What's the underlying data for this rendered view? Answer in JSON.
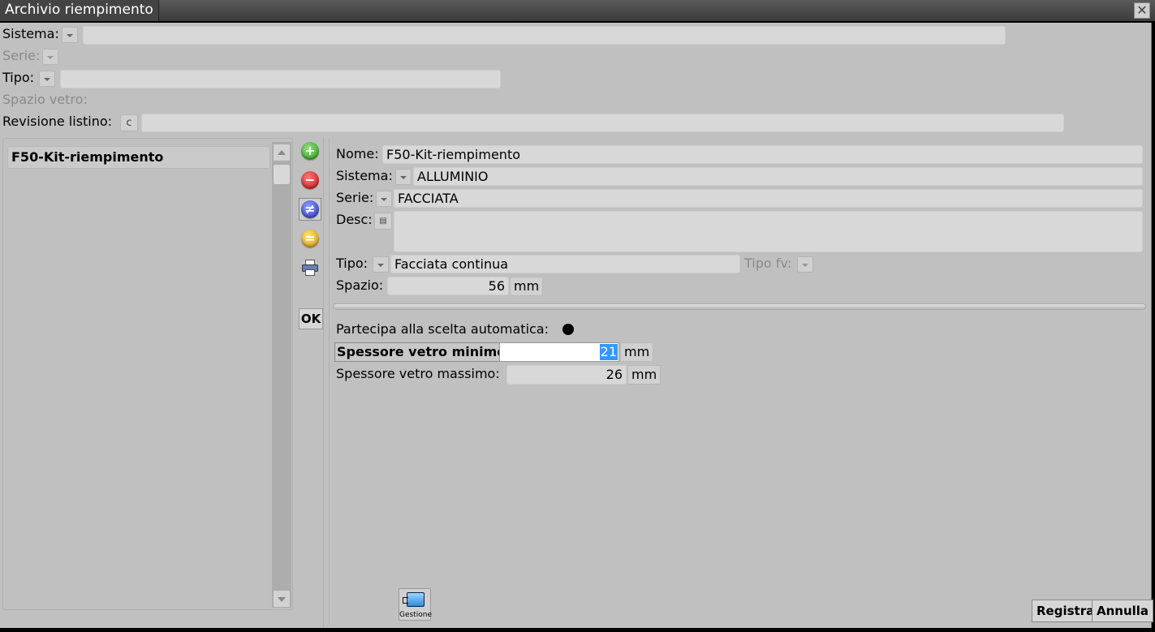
{
  "window": {
    "title": "Archivio riempimento",
    "close_glyph": "✕"
  },
  "filters": {
    "sistema_label": "Sistema:",
    "serie_label": "Serie:",
    "tipo_label": "Tipo:",
    "spazio_vetro_label": "Spazio vetro:",
    "revisione_label": "Revisione listino:",
    "revisione_button": "c",
    "sistema_value": "",
    "tipo_value": "",
    "revisione_value": ""
  },
  "list": {
    "items": [
      {
        "label": "F50-Kit-riempimento"
      }
    ]
  },
  "toolbar": {
    "ok_label": "OK"
  },
  "detail": {
    "nome_label": "Nome:",
    "nome_value": "F50-Kit-riempimento",
    "sistema_label": "Sistema:",
    "sistema_value": "ALLUMINIO",
    "serie_label": "Serie:",
    "serie_value": "FACCIATA",
    "desc_label": "Desc:",
    "desc_value": "",
    "tipo_label": "Tipo:",
    "tipo_value": "Facciata continua",
    "tipo_fv_label": "Tipo fv:",
    "spazio_label": "Spazio:",
    "spazio_value": "56",
    "spazio_unit": "mm",
    "partecipa_label": "Partecipa alla scelta automatica:",
    "partecipa_checked": true,
    "spessore_min_label": "Spessore vetro minimo:",
    "spessore_min_value": "21",
    "spessore_min_unit": "mm",
    "spessore_max_label": "Spessore vetro massimo:",
    "spessore_max_value": "26",
    "spessore_max_unit": "mm"
  },
  "footer": {
    "gestione_label": "Gestione",
    "registra_label": "Registra",
    "annulla_label": "Annulla"
  }
}
